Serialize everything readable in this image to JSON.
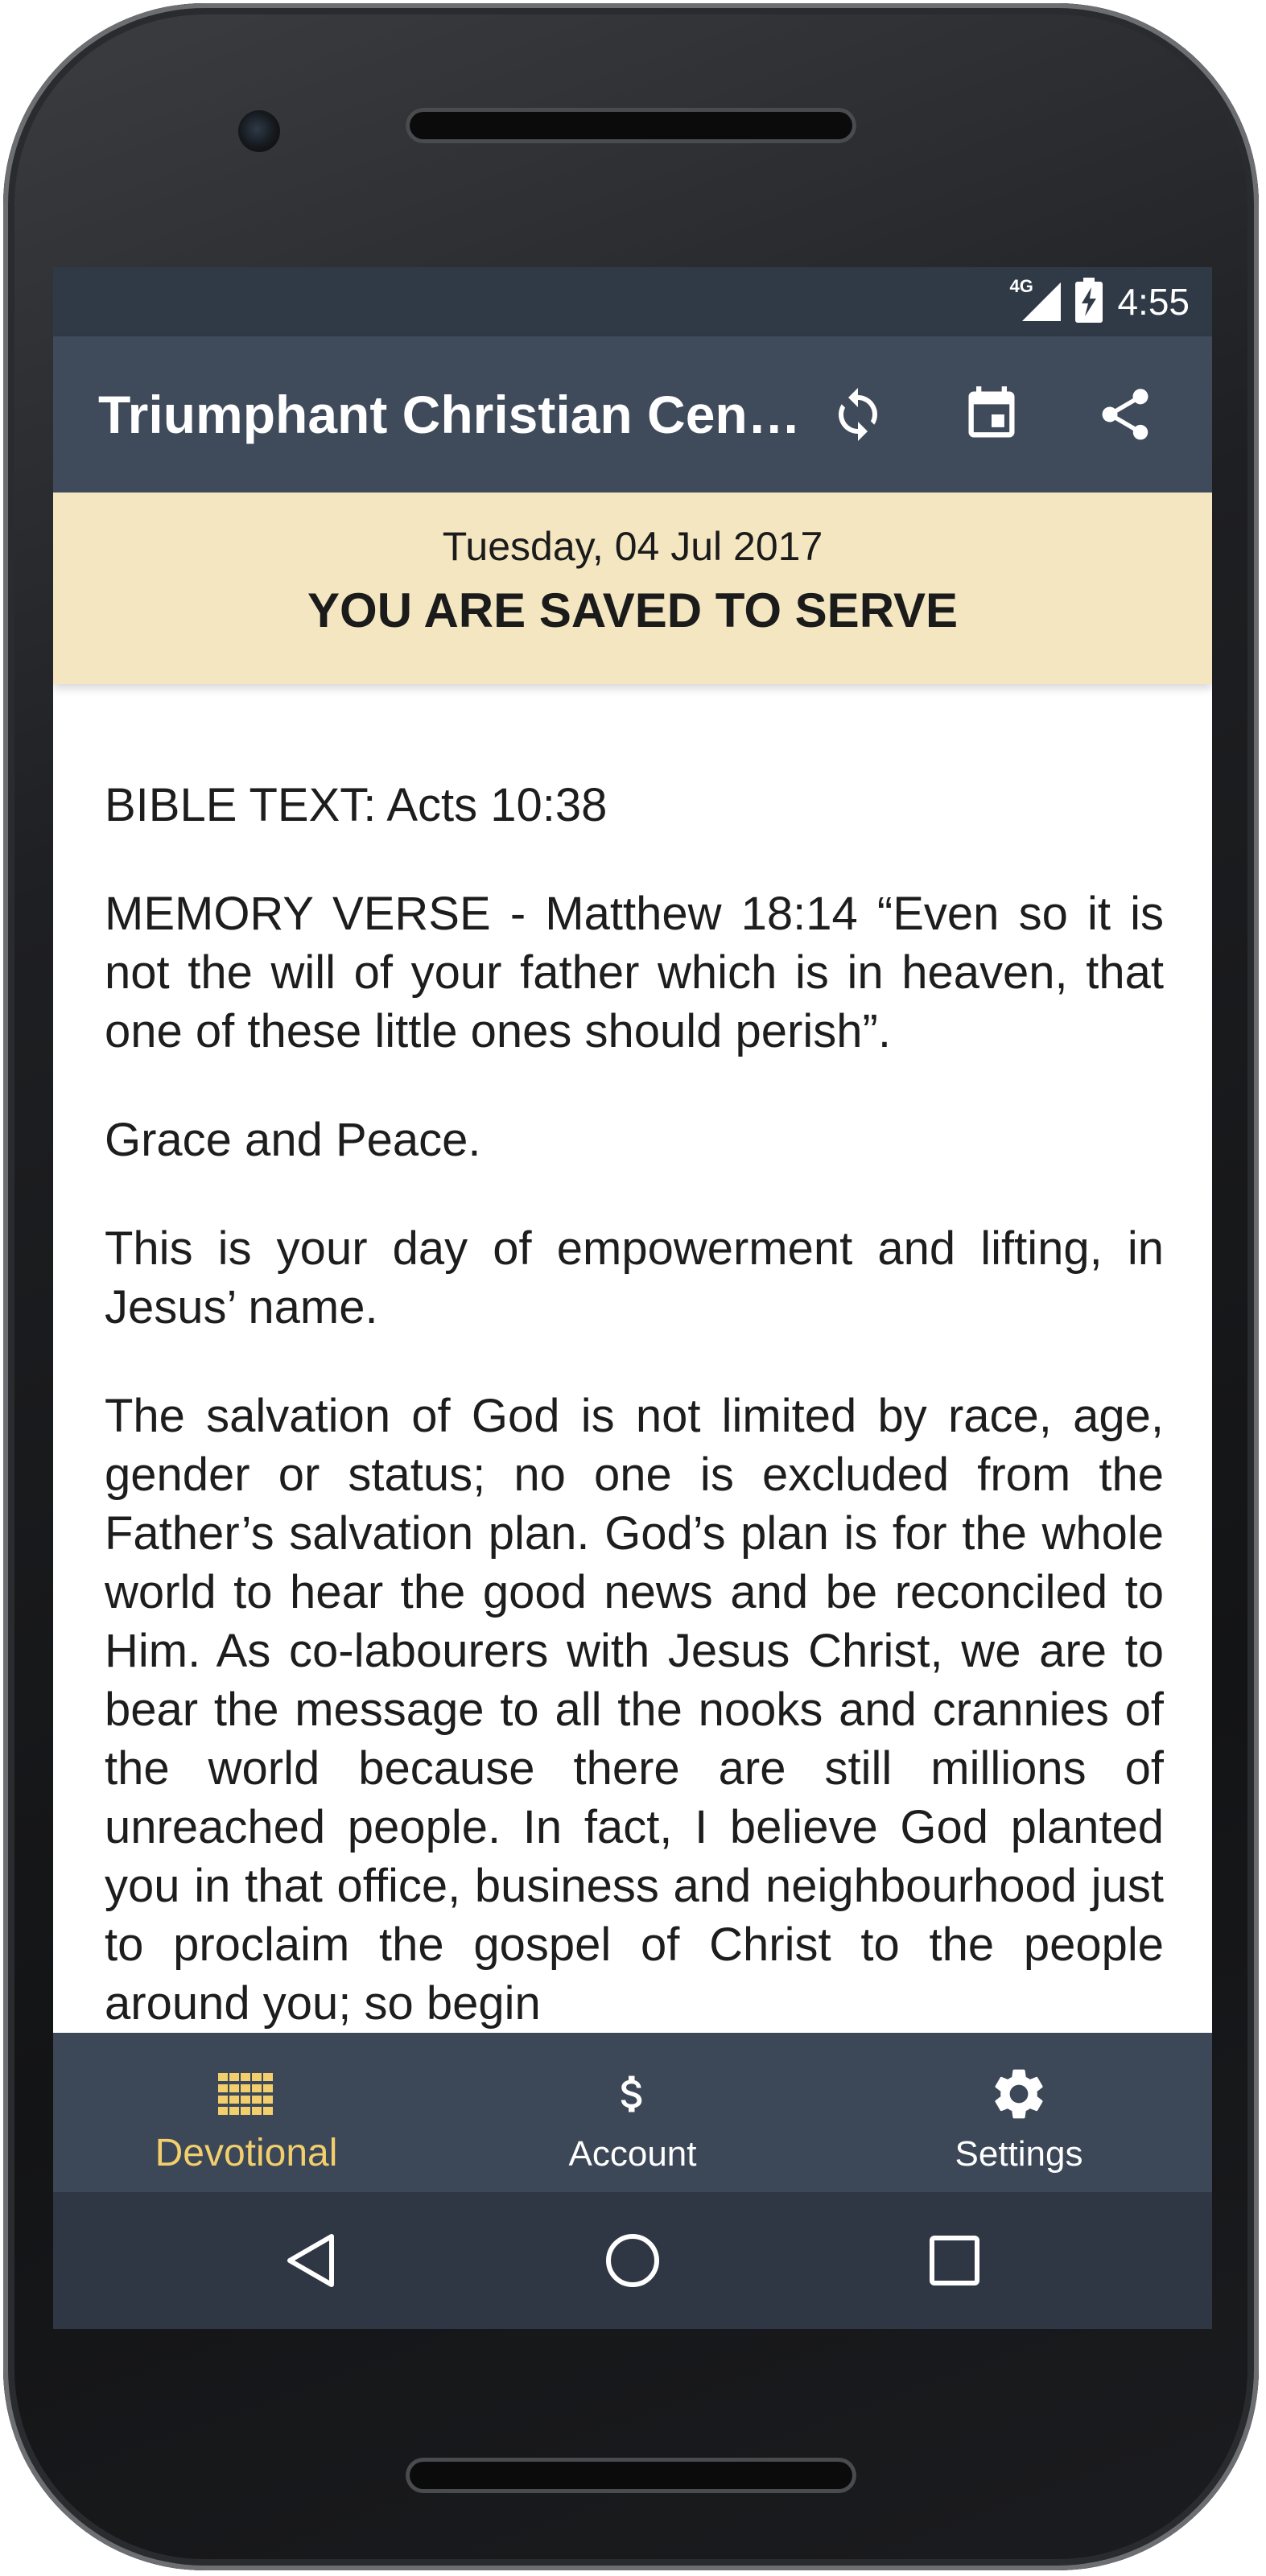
{
  "status_bar": {
    "network": "4G",
    "time": "4:55"
  },
  "app_bar": {
    "title": "Triumphant Christian Cen…",
    "icons": [
      "sync-icon",
      "calendar-icon",
      "share-icon"
    ]
  },
  "banner": {
    "date": "Tuesday, 04 Jul 2017",
    "title": "YOU ARE SAVED TO SERVE"
  },
  "content": {
    "paragraphs": [
      "BIBLE TEXT: Acts 10:38",
      "MEMORY VERSE - Matthew 18:14 “Even so it is not the will of your father which is in heaven, that one of these little ones should perish”.",
      "Grace and Peace.",
      "This is your day of empowerment and lifting, in Jesus’ name.",
      "The salvation of God is not limited by race, age, gender or status; no one is excluded from the Father’s salvation plan. God’s plan is for the whole world to hear the good news and be reconciled to Him. As co-labourers with Jesus Christ, we are to bear the message to all the nooks and crannies of the world because there are still millions of unreached people. In fact, I believe God planted you in that office, business and neighbourhood just to proclaim the gospel of Christ to the people around you; so begin"
    ]
  },
  "bottom_nav": {
    "items": [
      {
        "label": "Devotional",
        "icon": "grid-icon",
        "active": true
      },
      {
        "label": "Account",
        "icon": "dollar-icon",
        "active": false
      },
      {
        "label": "Settings",
        "icon": "gear-icon",
        "active": false
      }
    ]
  },
  "colors": {
    "status_bar": "#303a47",
    "app_bar": "#3f4b5b",
    "banner": "#f3e6c0",
    "bottom_nav": "#3c4757",
    "active_tab": "#f2cf6c",
    "system_nav": "#2f3744"
  }
}
